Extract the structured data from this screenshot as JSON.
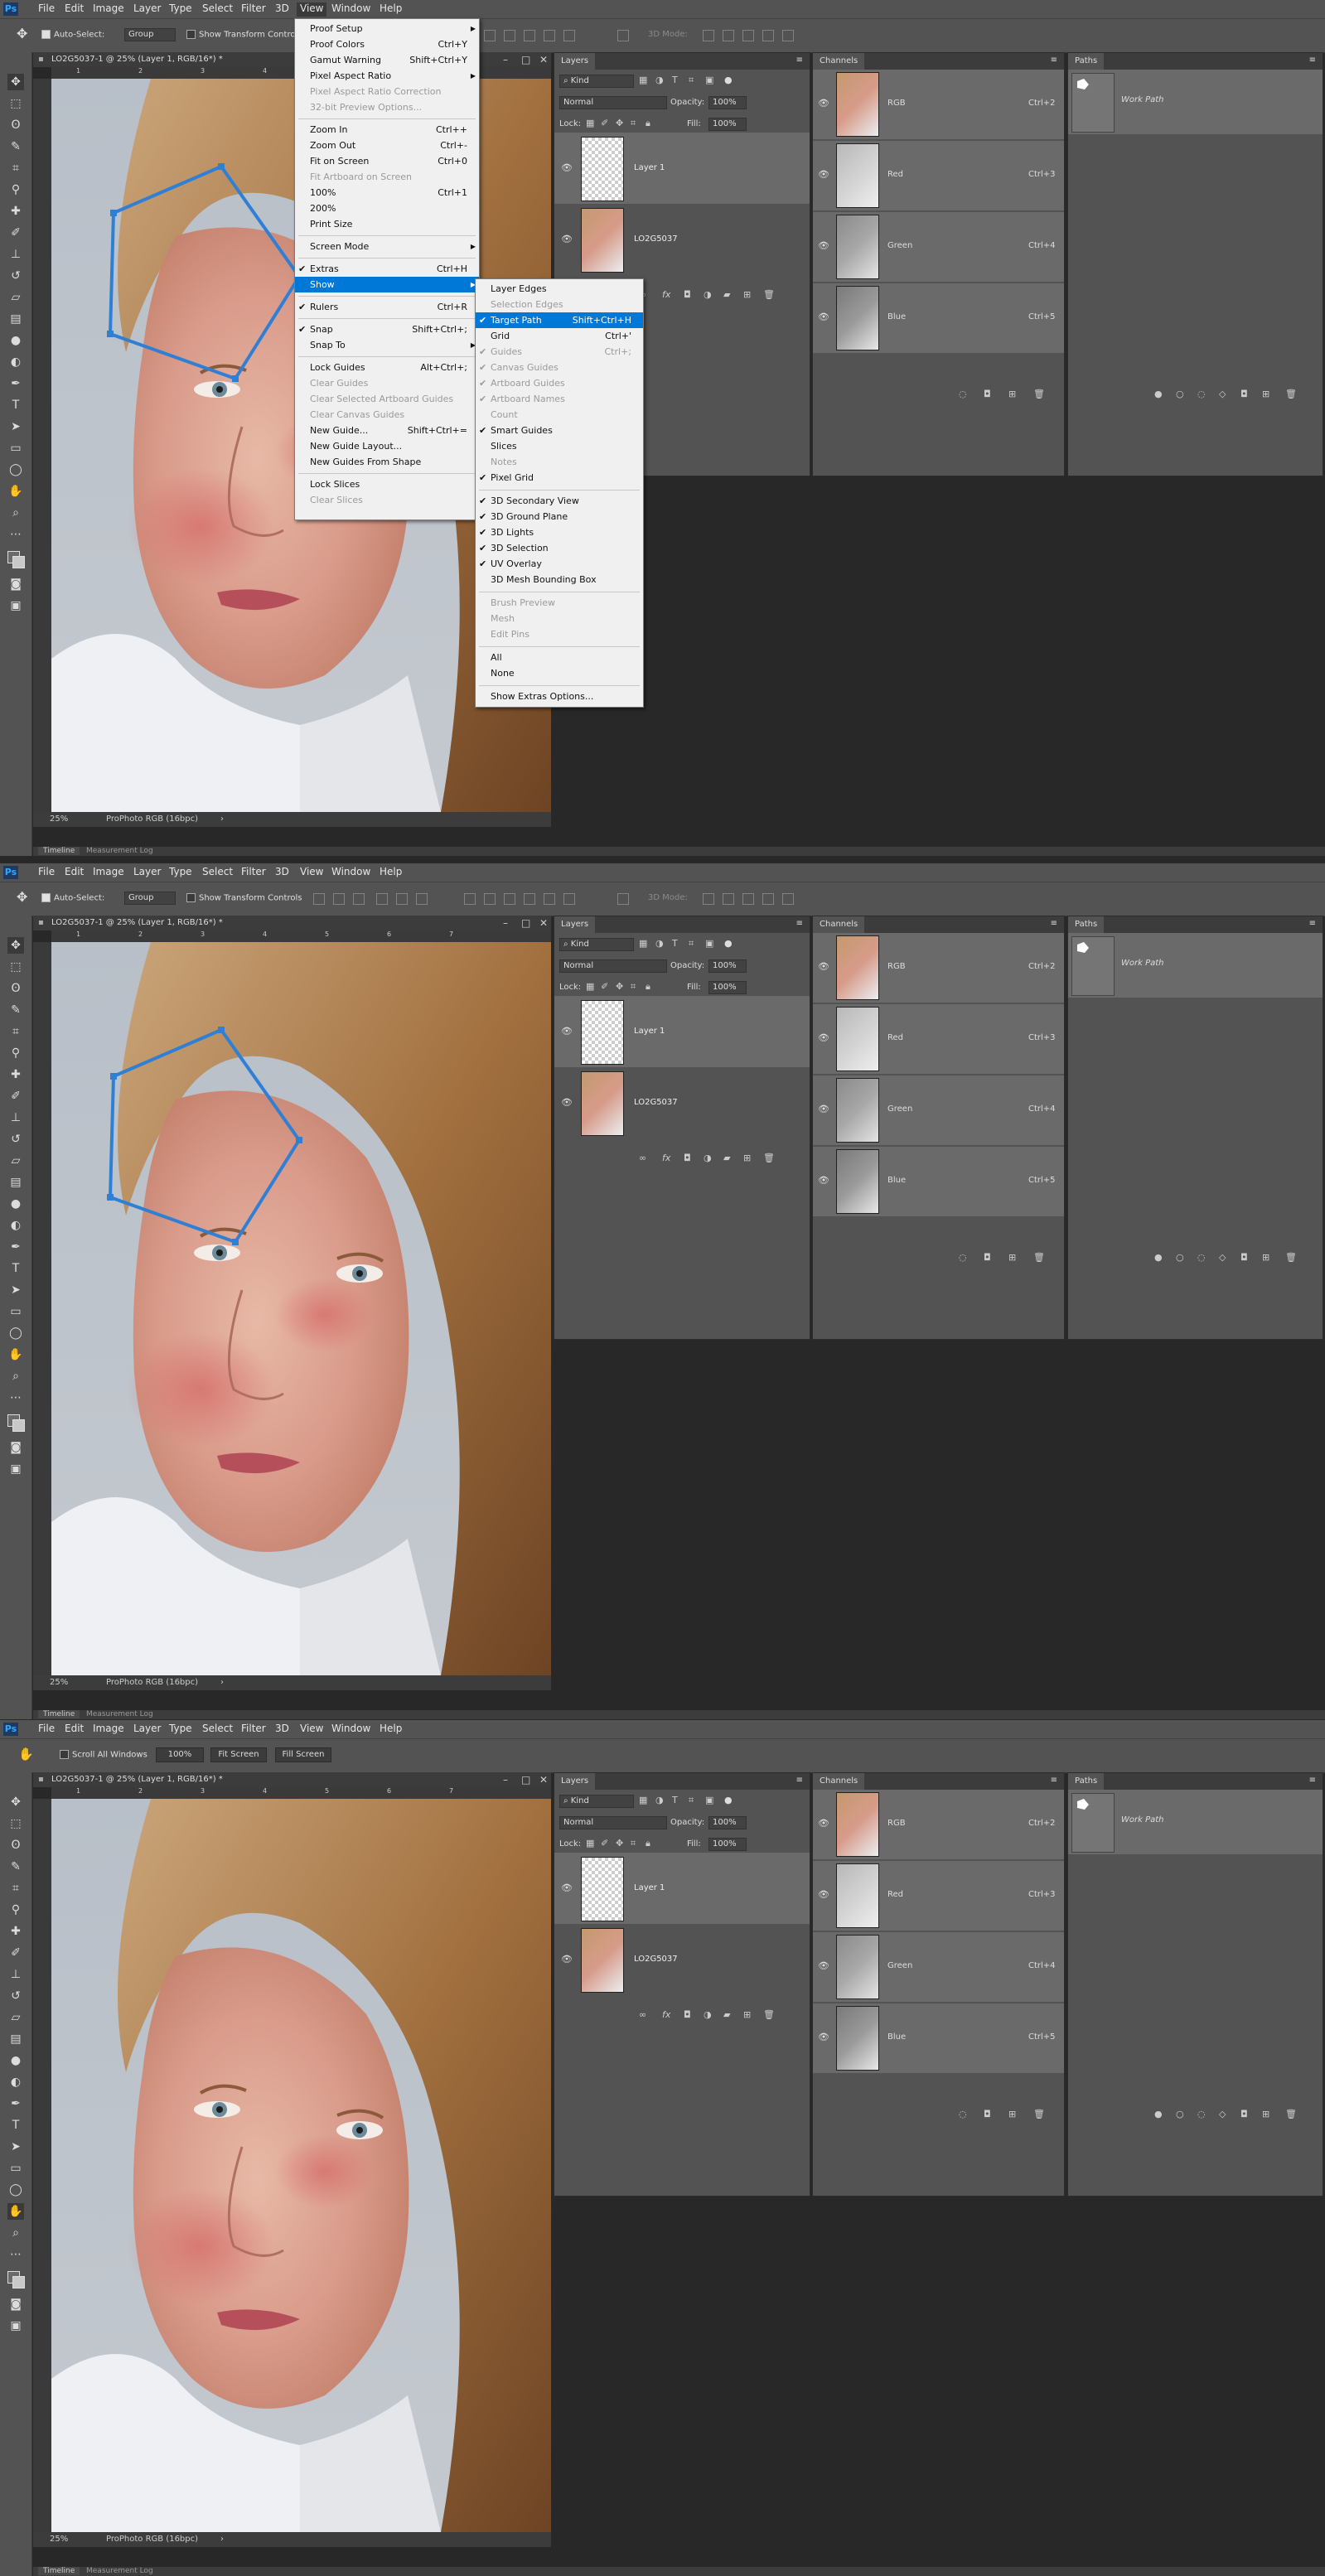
{
  "app": {
    "logo": "Ps"
  },
  "menu": [
    "File",
    "Edit",
    "Image",
    "Layer",
    "Type",
    "Select",
    "Filter",
    "3D",
    "View",
    "Window",
    "Help"
  ],
  "move_options": {
    "auto_select": "Auto-Select:",
    "group": "Group",
    "transform": "Show Transform Controls",
    "mode3d": "3D Mode:"
  },
  "hand_options": {
    "scroll_all": "Scroll All Windows",
    "zoom": "100%",
    "fit": "Fit Screen",
    "fill": "Fill Screen"
  },
  "doc": {
    "title": "LO2G5037-1 @ 25% (Layer 1, RGB/16*) *",
    "zoom": "25%",
    "profile": "ProPhoto RGB (16bpc)",
    "ruler_ticks": [
      "1",
      "2",
      "3",
      "4",
      "5",
      "6",
      "7"
    ]
  },
  "timeline": {
    "tab1": "Timeline",
    "tab2": "Measurement Log"
  },
  "layers": {
    "tab": "Layers",
    "kind": "Kind",
    "blend": "Normal",
    "opacity_label": "Opacity:",
    "opacity": "100%",
    "lock_label": "Lock:",
    "fill_label": "Fill:",
    "fill": "100%",
    "items": [
      {
        "name": "Layer 1"
      },
      {
        "name": "LO2G5037"
      }
    ]
  },
  "channels": {
    "tab": "Channels",
    "items": [
      {
        "name": "RGB",
        "shortcut": "Ctrl+2"
      },
      {
        "name": "Red",
        "shortcut": "Ctrl+3"
      },
      {
        "name": "Green",
        "shortcut": "Ctrl+4"
      },
      {
        "name": "Blue",
        "shortcut": "Ctrl+5"
      }
    ]
  },
  "paths": {
    "tab": "Paths",
    "items": [
      {
        "name": "Work Path"
      }
    ]
  },
  "view_menu": [
    {
      "label": "Proof Setup",
      "arrow": true
    },
    {
      "label": "Proof Colors",
      "shortcut": "Ctrl+Y"
    },
    {
      "label": "Gamut Warning",
      "shortcut": "Shift+Ctrl+Y"
    },
    {
      "label": "Pixel Aspect Ratio",
      "arrow": true
    },
    {
      "label": "Pixel Aspect Ratio Correction",
      "disabled": true
    },
    {
      "label": "32-bit Preview Options...",
      "disabled": true
    },
    {
      "sep": true
    },
    {
      "label": "Zoom In",
      "shortcut": "Ctrl++"
    },
    {
      "label": "Zoom Out",
      "shortcut": "Ctrl+-"
    },
    {
      "label": "Fit on Screen",
      "shortcut": "Ctrl+0"
    },
    {
      "label": "Fit Artboard on Screen",
      "disabled": true
    },
    {
      "label": "100%",
      "shortcut": "Ctrl+1"
    },
    {
      "label": "200%"
    },
    {
      "label": "Print Size"
    },
    {
      "sep": true
    },
    {
      "label": "Screen Mode",
      "arrow": true
    },
    {
      "sep": true
    },
    {
      "label": "Extras",
      "shortcut": "Ctrl+H",
      "check": true
    },
    {
      "label": "Show",
      "arrow": true,
      "highlight": true
    },
    {
      "sep": true
    },
    {
      "label": "Rulers",
      "shortcut": "Ctrl+R",
      "check": true
    },
    {
      "sep": true
    },
    {
      "label": "Snap",
      "shortcut": "Shift+Ctrl+;",
      "check": true
    },
    {
      "label": "Snap To",
      "arrow": true
    },
    {
      "sep": true
    },
    {
      "label": "Lock Guides",
      "shortcut": "Alt+Ctrl+;"
    },
    {
      "label": "Clear Guides",
      "disabled": true
    },
    {
      "label": "Clear Selected Artboard Guides",
      "disabled": true
    },
    {
      "label": "Clear Canvas Guides",
      "disabled": true
    },
    {
      "label": "New Guide...",
      "shortcut": "Shift+Ctrl+="
    },
    {
      "label": "New Guide Layout..."
    },
    {
      "label": "New Guides From Shape"
    },
    {
      "sep": true
    },
    {
      "label": "Lock Slices"
    },
    {
      "label": "Clear Slices",
      "disabled": true
    }
  ],
  "show_menu": [
    {
      "label": "Layer Edges"
    },
    {
      "label": "Selection Edges",
      "disabled": true
    },
    {
      "label": "Target Path",
      "shortcut": "Shift+Ctrl+H",
      "check": true,
      "highlight": true
    },
    {
      "label": "Grid",
      "shortcut": "Ctrl+'"
    },
    {
      "label": "Guides",
      "shortcut": "Ctrl+;",
      "check": true,
      "disabled": true
    },
    {
      "label": "Canvas Guides",
      "check": true,
      "disabled": true
    },
    {
      "label": "Artboard Guides",
      "check": true,
      "disabled": true
    },
    {
      "label": "Artboard Names",
      "check": true,
      "disabled": true
    },
    {
      "label": "Count",
      "disabled": true
    },
    {
      "label": "Smart Guides",
      "check": true
    },
    {
      "label": "Slices"
    },
    {
      "label": "Notes",
      "disabled": true
    },
    {
      "label": "Pixel Grid",
      "check": true
    },
    {
      "sep": true
    },
    {
      "label": "3D Secondary View",
      "check": true
    },
    {
      "label": "3D Ground Plane",
      "check": true
    },
    {
      "label": "3D Lights",
      "check": true
    },
    {
      "label": "3D Selection",
      "check": true
    },
    {
      "label": "UV Overlay",
      "check": true
    },
    {
      "label": "3D Mesh Bounding Box"
    },
    {
      "sep": true
    },
    {
      "label": "Brush Preview",
      "disabled": true
    },
    {
      "label": "Mesh",
      "disabled": true
    },
    {
      "label": "Edit Pins",
      "disabled": true
    },
    {
      "sep": true
    },
    {
      "label": "All"
    },
    {
      "label": "None"
    },
    {
      "sep": true
    },
    {
      "label": "Show Extras Options..."
    }
  ],
  "colors": {
    "path": "#2f7fd4",
    "highlight": "#0078d7",
    "menu_bg": "#f0f0f0",
    "panel_bg": "#535353"
  }
}
